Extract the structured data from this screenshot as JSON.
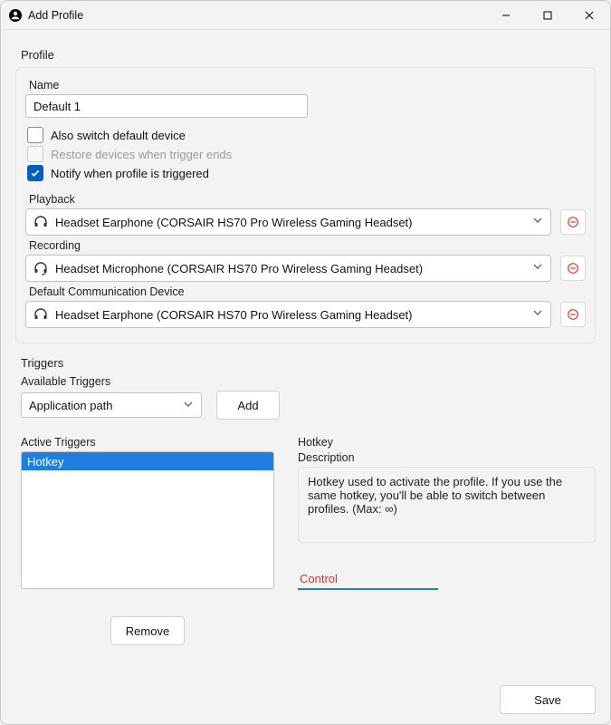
{
  "window": {
    "title": "Add Profile"
  },
  "profile": {
    "section_label": "Profile",
    "name_label": "Name",
    "name_value": "Default 1",
    "also_switch_label": "Also switch default device",
    "also_switch_checked": false,
    "restore_label": "Restore devices when trigger ends",
    "restore_checked": false,
    "restore_disabled": true,
    "notify_label": "Notify when profile is triggered",
    "notify_checked": true
  },
  "devices": {
    "playback_label": "Playback",
    "playback_value": "Headset Earphone (CORSAIR HS70 Pro Wireless Gaming Headset)",
    "recording_label": "Recording",
    "recording_value": "Headset Microphone (CORSAIR HS70 Pro Wireless Gaming Headset)",
    "comm_label": "Default Communication Device",
    "comm_value": "Headset Earphone (CORSAIR HS70 Pro Wireless Gaming Headset)"
  },
  "triggers": {
    "section_label": "Triggers",
    "available_label": "Available Triggers",
    "available_value": "Application path",
    "add_label": "Add",
    "active_label": "Active Triggers",
    "active_items": [
      "Hotkey"
    ],
    "active_selected_index": 0,
    "remove_label": "Remove",
    "detail_title": "Hotkey",
    "description_label": "Description",
    "description_text": "Hotkey used to activate the profile. If you use the same hotkey, you'll be able to switch between profiles. (Max: ∞)",
    "hotkey_value": "Control"
  },
  "footer": {
    "save_label": "Save"
  }
}
